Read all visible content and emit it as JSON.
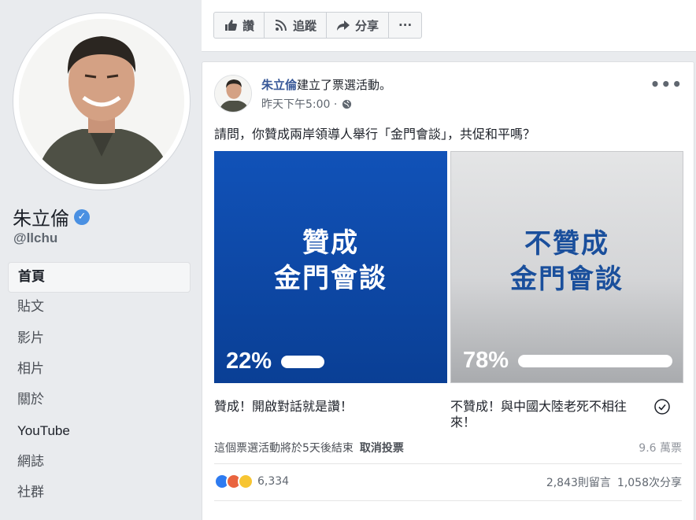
{
  "profile": {
    "name": "朱立倫",
    "handle": "@llchu",
    "verified_icon": "verified-badge-icon"
  },
  "nav": {
    "items": [
      {
        "label": "首頁",
        "active": true
      },
      {
        "label": "貼文"
      },
      {
        "label": "影片"
      },
      {
        "label": "相片"
      },
      {
        "label": "關於"
      },
      {
        "label": "YouTube"
      },
      {
        "label": "網誌"
      },
      {
        "label": "社群"
      }
    ]
  },
  "actions": {
    "like": "讚",
    "follow": "追蹤",
    "share": "分享",
    "more": "···"
  },
  "post": {
    "author": "朱立倫",
    "action_text": "建立了票選活動。",
    "timestamp": "昨天下午5:00 ·",
    "privacy_icon": "globe-icon",
    "more": "•••",
    "question": "請問，你贊成兩岸領導人舉行「金門會談」，共促和平嗎？"
  },
  "poll": {
    "options": [
      {
        "title_line1": "贊成",
        "title_line2": "金門會談",
        "percent_label": "22%",
        "percent": 22,
        "label": "贊成！開啟對話就是讚！"
      },
      {
        "title_line1": "不贊成",
        "title_line2": "金門會談",
        "percent_label": "78%",
        "percent": 78,
        "label": "不贊成！與中國大陸老死不相往來！",
        "selected": true
      }
    ],
    "footer": "這個票選活動將於5天後結束",
    "cancel_vote": "取消投票",
    "votes": "9.6 萬票"
  },
  "engagement": {
    "reaction_count": "6,334",
    "comments": "2,843則留言",
    "shares": "1,058次分享"
  },
  "colors": {
    "option_a": "#0d4aa8",
    "option_b_text": "#1a4f9c",
    "link": "#385898"
  }
}
